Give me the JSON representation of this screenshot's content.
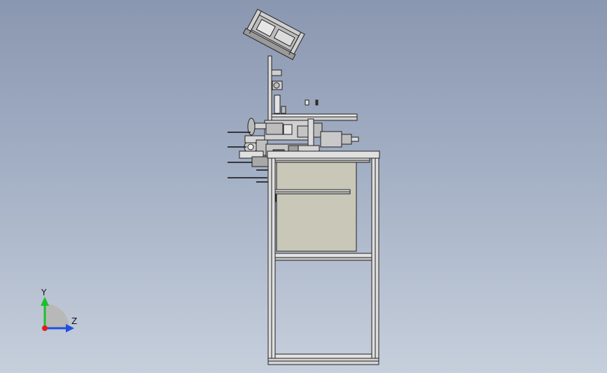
{
  "viewport": {
    "background_top": "#8a97b0",
    "background_bottom": "#c6cfdc"
  },
  "model": {
    "frame_color": "#d9d9d9",
    "panel_color": "#c8c7b8",
    "edge_color": "#222222"
  },
  "triad": {
    "y_label": "Y",
    "z_label": "Z",
    "y_color": "#1fbf2a",
    "z_color": "#1e4fe0",
    "x_color": "#e01e1e"
  }
}
